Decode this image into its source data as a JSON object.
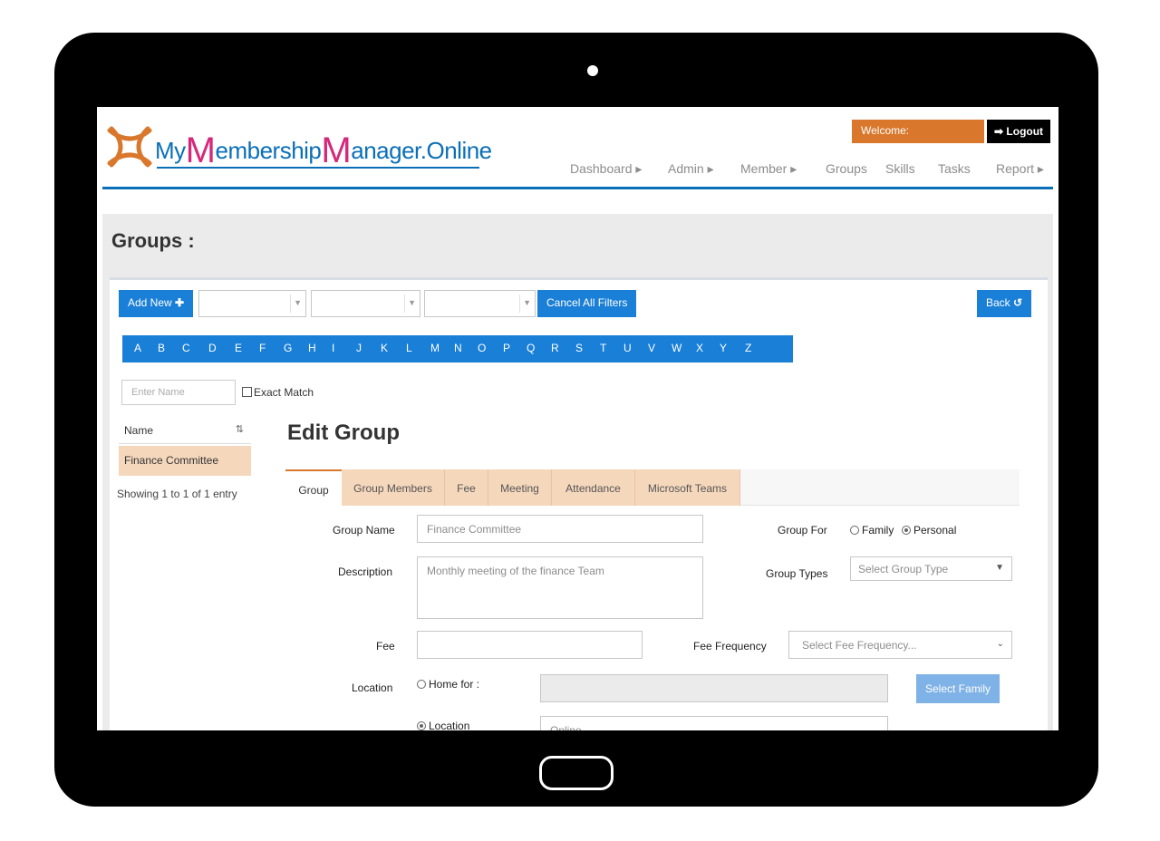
{
  "brand": {
    "logo_my": "My",
    "logo_m": "M",
    "logo_rest": "embership",
    "logo_m2": "M",
    "logo_rest2": "anager.Online",
    "accent": "#1a7fd6",
    "orange": "#d9782d",
    "peach": "#f5d7bc"
  },
  "header": {
    "welcome": "Welcome:",
    "logout": "Logout",
    "nav": [
      "Dashboard ▸",
      "Admin ▸",
      "Member ▸",
      "Groups",
      "Skills",
      "Tasks",
      "Report ▸"
    ]
  },
  "page": {
    "title": "Groups :"
  },
  "toolbar": {
    "add_new": "Add New",
    "cancel_filters": "Cancel All Filters",
    "back": "Back"
  },
  "alphabet": [
    "A",
    "B",
    "C",
    "D",
    "E",
    "F",
    "G",
    "H",
    "I",
    "J",
    "K",
    "L",
    "M",
    "N",
    "O",
    "P",
    "Q",
    "R",
    "S",
    "T",
    "U",
    "V",
    "W",
    "X",
    "Y",
    "Z"
  ],
  "filter": {
    "name_placeholder": "Enter Name",
    "exact_match": "Exact Match"
  },
  "sidebar": {
    "column": "Name",
    "rows": [
      "Finance Committee"
    ],
    "info": "Showing 1 to 1 of 1 entry"
  },
  "edit": {
    "title": "Edit Group",
    "tabs": [
      "Group",
      "Group Members",
      "Fee",
      "Meeting",
      "Attendance",
      "Microsoft Teams"
    ],
    "active_tab": "Group"
  },
  "form": {
    "group_name_label": "Group Name",
    "group_name_value": "Finance Committee",
    "group_for_label": "Group For",
    "family": "Family",
    "personal": "Personal",
    "description_label": "Description",
    "description_value": "Monthly meeting of the finance Team",
    "group_types_label": "Group Types",
    "group_types_value": "Select Group Type",
    "fee_label": "Fee",
    "fee_value": "",
    "fee_frequency_label": "Fee Frequency",
    "fee_frequency_value": "Select Fee Frequency...",
    "location_label": "Location",
    "home_for": "Home for :",
    "select_family": "Select Family",
    "location_option": "Location",
    "location_value": "Online"
  }
}
